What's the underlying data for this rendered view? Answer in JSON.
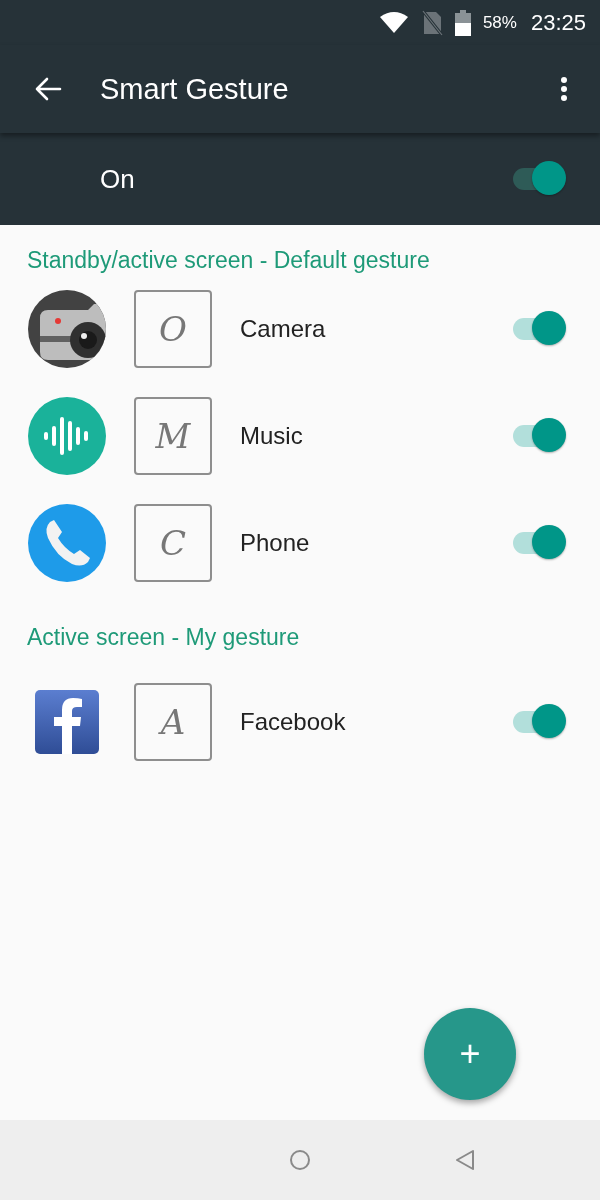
{
  "status_bar": {
    "battery": "58%",
    "time": "23:25"
  },
  "toolbar": {
    "title": "Smart Gesture"
  },
  "master_switch": {
    "label": "On",
    "on": true
  },
  "sections": [
    {
      "title": "Standby/active screen - Default gesture",
      "items": [
        {
          "gesture": "O",
          "label": "Camera",
          "on": true
        },
        {
          "gesture": "M",
          "label": "Music",
          "on": true
        },
        {
          "gesture": "C",
          "label": "Phone",
          "on": true
        }
      ]
    },
    {
      "title": "Active screen - My gesture",
      "items": [
        {
          "gesture": "A",
          "label": "Facebook",
          "on": true
        }
      ]
    }
  ],
  "fab": {
    "label": "+"
  }
}
